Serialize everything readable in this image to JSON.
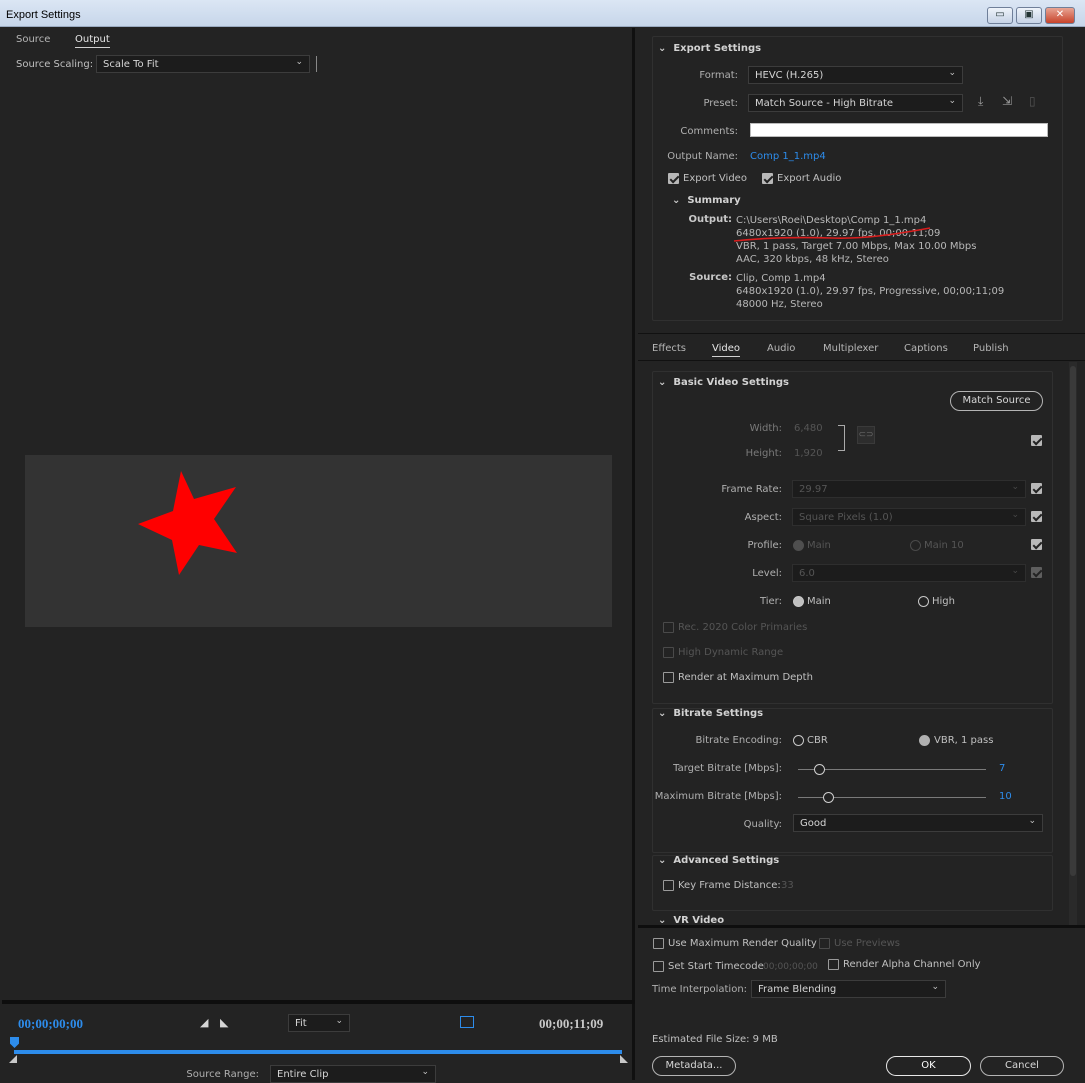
{
  "window": {
    "title": "Export Settings",
    "controls": [
      "▭",
      "▣",
      "✕"
    ]
  },
  "left": {
    "tabs": [
      "Source",
      "Output"
    ],
    "source_scaling_label": "Source Scaling:",
    "source_scaling_value": "Scale To Fit",
    "timecode_start": "00;00;00;00",
    "timecode_end": "00;00;11;09",
    "zoom_value": "Fit",
    "source_range_label": "Source Range:",
    "source_range_value": "Entire Clip"
  },
  "export": {
    "section_title": "Export Settings",
    "format_label": "Format:",
    "format_value": "HEVC (H.265)",
    "preset_label": "Preset:",
    "preset_value": "Match Source - High Bitrate",
    "comments_label": "Comments:",
    "output_name_label": "Output Name:",
    "output_name_value": "Comp 1_1.mp4",
    "export_video": "Export Video",
    "export_audio": "Export Audio",
    "summary_title": "Summary",
    "output_label": "Output:",
    "output_lines": [
      "C:\\Users\\Roei\\Desktop\\Comp 1_1.mp4",
      "6480x1920 (1.0), 29.97 fps, 00;00;11;09",
      "VBR, 1 pass, Target 7.00 Mbps, Max 10.00 Mbps",
      "AAC, 320 kbps, 48 kHz, Stereo"
    ],
    "source_label": "Source:",
    "source_lines": [
      "Clip, Comp 1.mp4",
      "6480x1920 (1.0), 29.97 fps, Progressive, 00;00;11;09",
      "48000 Hz, Stereo"
    ]
  },
  "tabs": [
    "Effects",
    "Video",
    "Audio",
    "Multiplexer",
    "Captions",
    "Publish"
  ],
  "basic": {
    "title": "Basic Video Settings",
    "match_source": "Match Source",
    "width_label": "Width:",
    "width_value": "6,480",
    "height_label": "Height:",
    "height_value": "1,920",
    "frame_rate_label": "Frame Rate:",
    "frame_rate_value": "29.97",
    "aspect_label": "Aspect:",
    "aspect_value": "Square Pixels (1.0)",
    "profile_label": "Profile:",
    "profile_main": "Main",
    "profile_main10": "Main 10",
    "level_label": "Level:",
    "level_value": "6.0",
    "tier_label": "Tier:",
    "tier_main": "Main",
    "tier_high": "High",
    "rec2020": "Rec. 2020 Color Primaries",
    "hdr": "High Dynamic Range",
    "max_depth": "Render at Maximum Depth"
  },
  "bitrate": {
    "title": "Bitrate Settings",
    "encoding_label": "Bitrate Encoding:",
    "cbr": "CBR",
    "vbr": "VBR, 1 pass",
    "target_label": "Target Bitrate [Mbps]:",
    "target_value": "7",
    "max_label": "Maximum Bitrate [Mbps]:",
    "max_value": "10",
    "quality_label": "Quality:",
    "quality_value": "Good"
  },
  "advanced": {
    "title": "Advanced Settings",
    "keyframe_label": "Key Frame Distance:",
    "keyframe_value": "33"
  },
  "vr": {
    "title": "VR Video"
  },
  "bottom": {
    "max_quality": "Use Maximum Render Quality",
    "use_previews": "Use Previews",
    "start_timecode": "Set Start Timecode",
    "start_timecode_value": "00;00;00;00",
    "alpha_only": "Render Alpha Channel Only",
    "interp_label": "Time Interpolation:",
    "interp_value": "Frame Blending",
    "file_size": "Estimated File Size:  9 MB",
    "metadata": "Metadata...",
    "ok": "OK",
    "cancel": "Cancel"
  },
  "colors": {
    "accent": "#2d8ceb",
    "star": "#ff0000",
    "annotation": "#d81e1e"
  }
}
